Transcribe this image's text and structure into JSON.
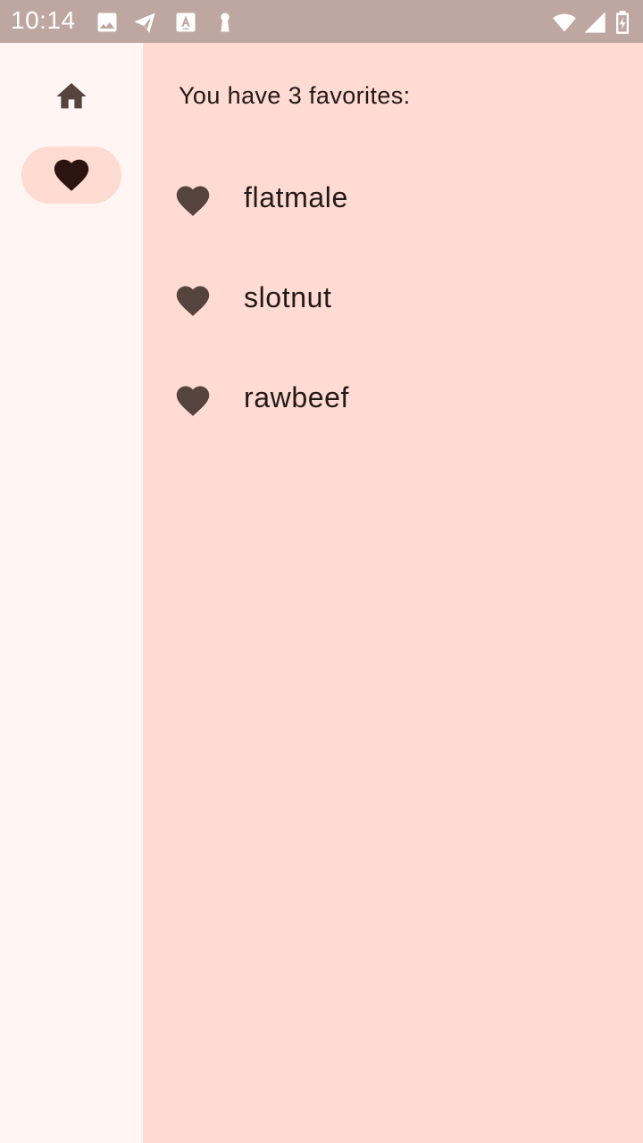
{
  "status_bar": {
    "time": "10:14",
    "icons": [
      "image-icon",
      "send-icon",
      "text-notification-icon",
      "keyhole-icon",
      "wifi-icon",
      "signal-icon",
      "battery-icon"
    ]
  },
  "nav_rail": {
    "destinations": [
      {
        "name": "home",
        "icon": "home-icon",
        "selected": false
      },
      {
        "name": "favorites",
        "icon": "heart-icon",
        "selected": true
      }
    ]
  },
  "main": {
    "heading": "You have 3 favorites:",
    "favorites": [
      {
        "label": "flatmale",
        "icon": "heart-icon"
      },
      {
        "label": "slotnut",
        "icon": "heart-icon"
      },
      {
        "label": "rawbeef",
        "icon": "heart-icon"
      }
    ]
  },
  "colors": {
    "status_bar_bg": "#bfa7a1",
    "rail_bg": "#fff6f4",
    "main_bg": "#ffdbd3",
    "selected_indicator": "#ffdbd1",
    "icon": "#55433e",
    "selected_icon": "#2c1510",
    "text": "#231917"
  }
}
